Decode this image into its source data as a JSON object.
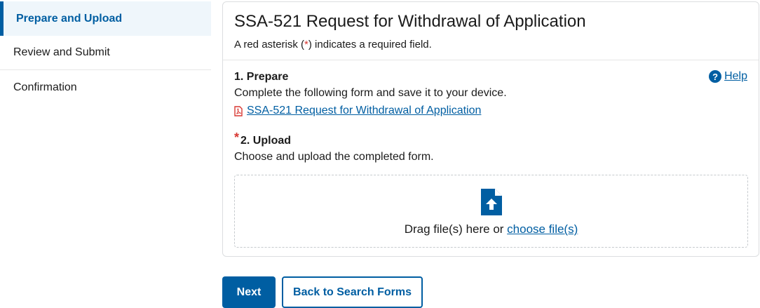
{
  "sidebar": {
    "items": [
      {
        "label": "Prepare and Upload",
        "active": true
      },
      {
        "label": "Review and Submit",
        "active": false
      },
      {
        "label": "Confirmation",
        "active": false
      }
    ]
  },
  "form": {
    "title": "SSA-521 Request for Withdrawal of Application",
    "required_note_prefix": "A red asterisk (",
    "required_note_star": "*",
    "required_note_suffix": ") indicates a required field.",
    "help_label": "Help",
    "prepare": {
      "title": "1. Prepare",
      "text": "Complete the following form and save it to your device.",
      "link": "SSA-521 Request for Withdrawal of Application"
    },
    "upload": {
      "asterisk": "*",
      "title": "2. Upload",
      "text": "Choose and upload the completed form.",
      "drop_text": "Drag file(s) here or ",
      "drop_link": "choose file(s)"
    }
  },
  "actions": {
    "next_label": "Next",
    "back_label": "Back to Search Forms"
  },
  "colors": {
    "primary": "#005ea2",
    "required": "#d83933",
    "pdf": "#d83933"
  },
  "icons": {
    "help": "question-circle-icon",
    "pdf": "file-pdf-icon",
    "upload": "file-upload-icon"
  }
}
